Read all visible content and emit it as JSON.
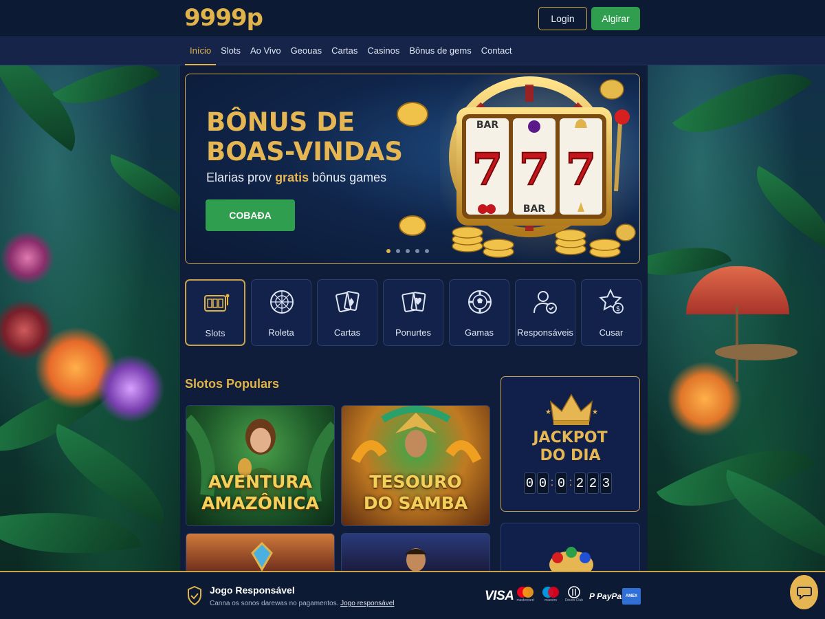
{
  "header": {
    "logo": "9999p",
    "login_label": "Login",
    "signup_label": "Algirar"
  },
  "nav": {
    "items": [
      "Início",
      "Slots",
      "Ao Vivo",
      "Geouas",
      "Cartas",
      "Casinos",
      "Bônus de gems",
      "Contact"
    ],
    "active": "Início"
  },
  "banner": {
    "title_line1": "BÔNUS DE",
    "title_line2": "BOAS-VINDAS",
    "subtitle_pre": "Elarias prov",
    "subtitle_highlight": "gratis",
    "subtitle_post": "bônus games",
    "cta_label": "COBAÐA",
    "slot_symbols": [
      "BAR",
      "7",
      "7",
      "7",
      "BAR"
    ],
    "slide_count": 5,
    "active_slide": 1
  },
  "categories": [
    {
      "label": "Slots",
      "icon": "slot-machine-icon",
      "active": true
    },
    {
      "label": "Roleta",
      "icon": "roulette-icon",
      "active": false
    },
    {
      "label": "Cartas",
      "icon": "playing-cards-icon",
      "active": false
    },
    {
      "label": "Ponurtes",
      "icon": "poker-cards-icon",
      "active": false
    },
    {
      "label": "Gamas",
      "icon": "chip-icon",
      "active": false
    },
    {
      "label": "Responsáveis",
      "icon": "user-shield-icon",
      "active": false
    },
    {
      "label": "Cusar",
      "icon": "star-coin-icon",
      "active": false
    }
  ],
  "popular": {
    "title": "Slotos Populars",
    "games": [
      {
        "line1": "AVENTURA",
        "line2": "AMAZÔNICA"
      },
      {
        "line1": "TESOURO",
        "line2": "DO SAMBA"
      }
    ]
  },
  "jackpot": {
    "title_line1": "JACKPOT",
    "title_line2": "DO DIA",
    "digits": [
      "0",
      "0",
      "0",
      "2",
      "2",
      "3"
    ]
  },
  "footer": {
    "title": "Jogo Responsável",
    "text": "Canna os sonos darewas no pagamentos.",
    "link": "Jogo responsável",
    "payments": [
      "VISA",
      "mastercard",
      "maestro",
      "Diners Club",
      "PayPal",
      "AMEX"
    ]
  },
  "colors": {
    "gold": "#e0b44a",
    "green": "#2f9e4f",
    "navy": "#0d1a33"
  }
}
